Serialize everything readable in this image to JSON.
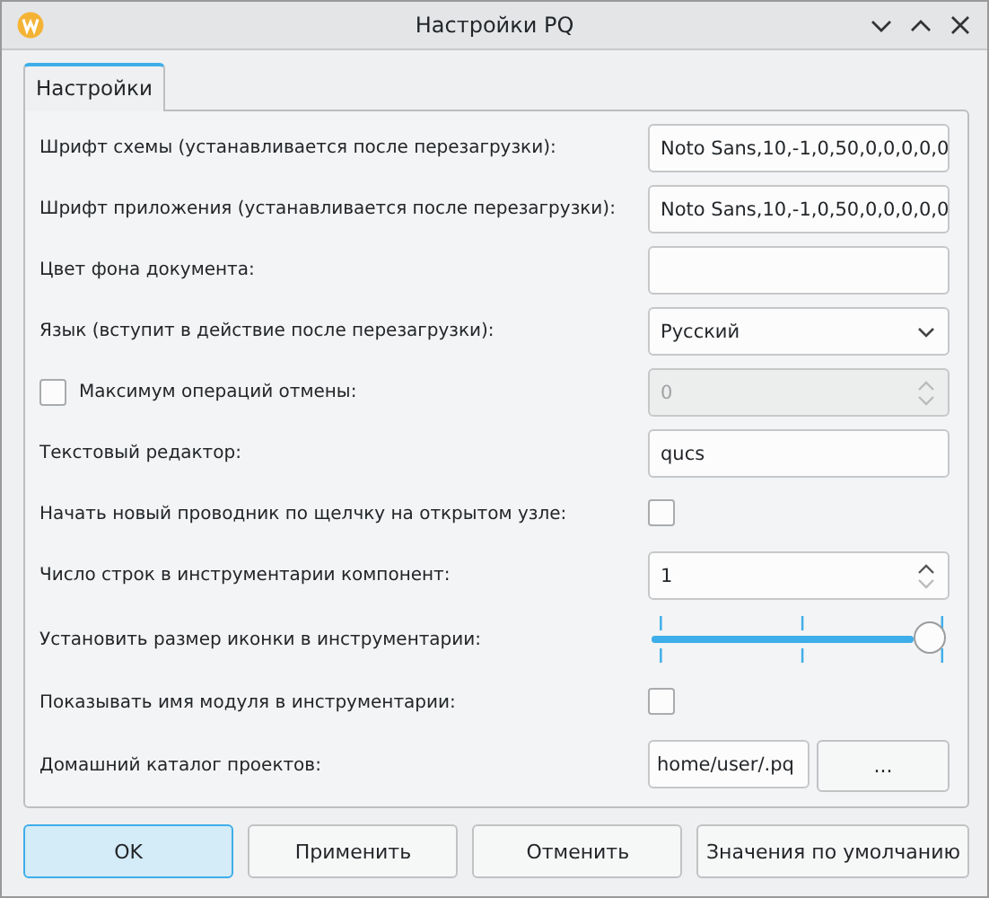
{
  "window": {
    "title": "Настройки PQ"
  },
  "tabs": [
    {
      "label": "Настройки",
      "selected": true
    }
  ],
  "rows": [
    {
      "kind": "text",
      "label": "Шрифт схемы (устанавливается после перезагрузки):",
      "value": "Noto Sans,10,-1,0,50,0,0,0,0,0"
    },
    {
      "kind": "text",
      "label": "Шрифт приложения (устанавливается после перезагрузки):",
      "value": "Noto Sans,10,-1,0,50,0,0,0,0,0"
    },
    {
      "kind": "color",
      "label": "Цвет фона документа:"
    },
    {
      "kind": "select",
      "label": "Язык (вступит в действие после перезагрузки):",
      "value": "Русский"
    },
    {
      "kind": "spin",
      "label": "Максимум операций отмены:",
      "value": "0",
      "checked": false,
      "disabled": true
    },
    {
      "kind": "text",
      "label": "Текстовый редактор:",
      "value": "qucs"
    },
    {
      "kind": "checkbox",
      "label": "Начать новый проводник по щелчку на открытом узле:",
      "checked": false
    },
    {
      "kind": "spin",
      "label": "Число строк в инструментарии компонент:",
      "value": "1",
      "disabled": false
    },
    {
      "kind": "slider",
      "label": "Установить размер иконки в инструментарии:",
      "level": 1
    },
    {
      "kind": "checkbox",
      "label": "Показывать имя модуля в инструментарии:",
      "checked": false
    },
    {
      "kind": "path",
      "label": "Домашний каталог проектов:",
      "value": "home/user/.pq",
      "button": "..."
    }
  ],
  "buttons": [
    {
      "label": "OK",
      "selected": true
    },
    {
      "label": "Применить",
      "selected": false
    },
    {
      "label": "Отменить",
      "selected": false
    },
    {
      "label": "Значения по умолчанию",
      "selected": false
    }
  ]
}
